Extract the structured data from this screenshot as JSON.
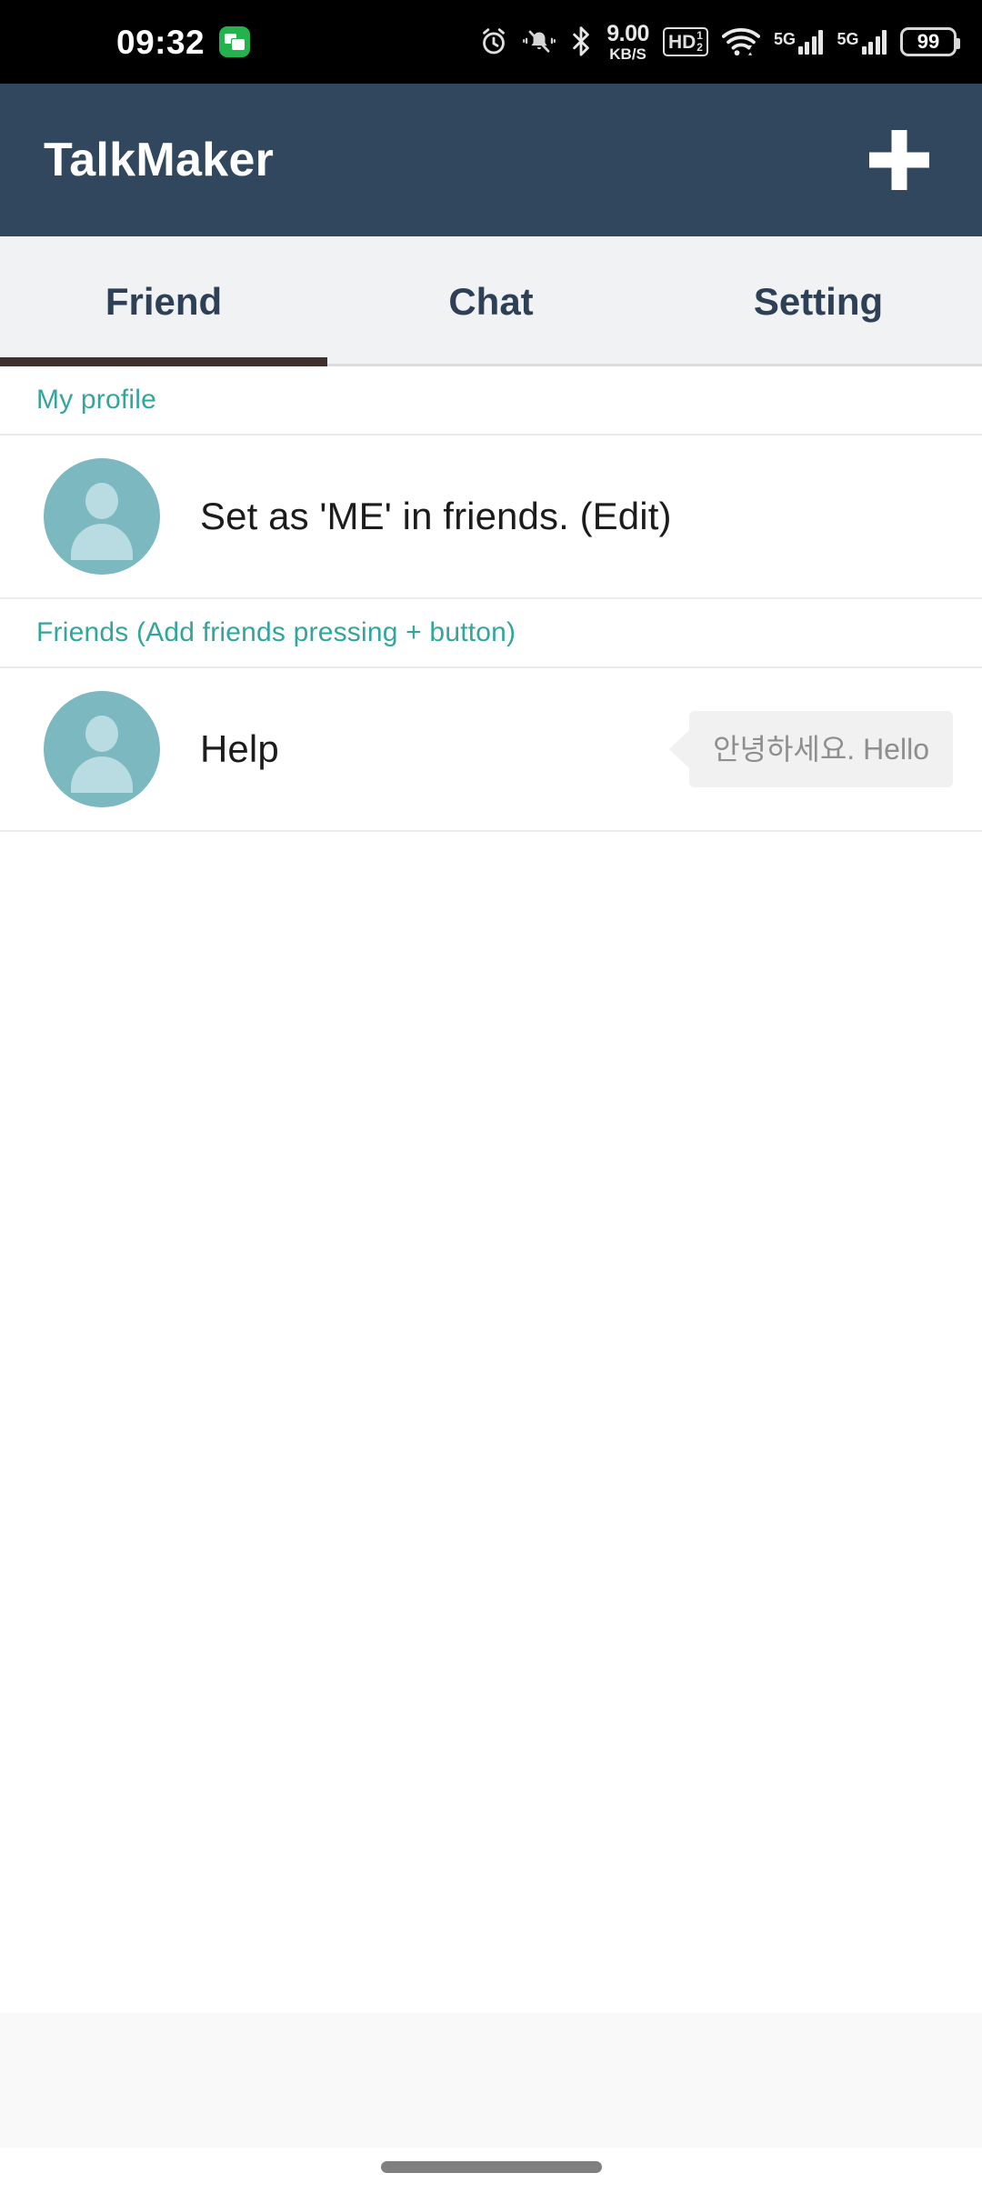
{
  "status_bar": {
    "time": "09:32",
    "notification_icon": "message-icon",
    "icons": [
      "alarm-icon",
      "silent-bell-icon",
      "bluetooth-icon"
    ],
    "network_speed_value": "9.00",
    "network_speed_unit": "KB/S",
    "hd_voice_label": "HD",
    "hd_voice_sup": "1",
    "hd_voice_sub": "2",
    "wifi_icon": "wifi-icon",
    "sim1_network": "5G",
    "sim2_network": "5G",
    "battery_percent": "99"
  },
  "app_bar": {
    "title": "TalkMaker",
    "add_button_icon": "plus-icon"
  },
  "tabs": [
    {
      "label": "Friend",
      "active": true
    },
    {
      "label": "Chat",
      "active": false
    },
    {
      "label": "Setting",
      "active": false
    }
  ],
  "sections": {
    "my_profile": {
      "header": "My profile",
      "row": {
        "avatar_icon": "person-avatar-icon",
        "name": "Set as 'ME' in friends. (Edit)"
      }
    },
    "friends": {
      "header": "Friends (Add friends pressing + button)",
      "rows": [
        {
          "avatar_icon": "person-avatar-icon",
          "name": "Help",
          "status_message": "안녕하세요. Hello"
        }
      ]
    }
  },
  "colors": {
    "app_bar": "#31475d",
    "tab_bar": "#f1f2f4",
    "tab_text": "#2e4055",
    "tab_indicator": "#3f2f2d",
    "section_header_text": "#33a69a",
    "avatar": "#7cb8c0",
    "avatar_glyph": "#b9dce2",
    "bubble_bg": "#f1f1f1",
    "bubble_text": "#8e8e8e",
    "status_bar": "#000000",
    "banner_bg": "#f9f9f9"
  }
}
